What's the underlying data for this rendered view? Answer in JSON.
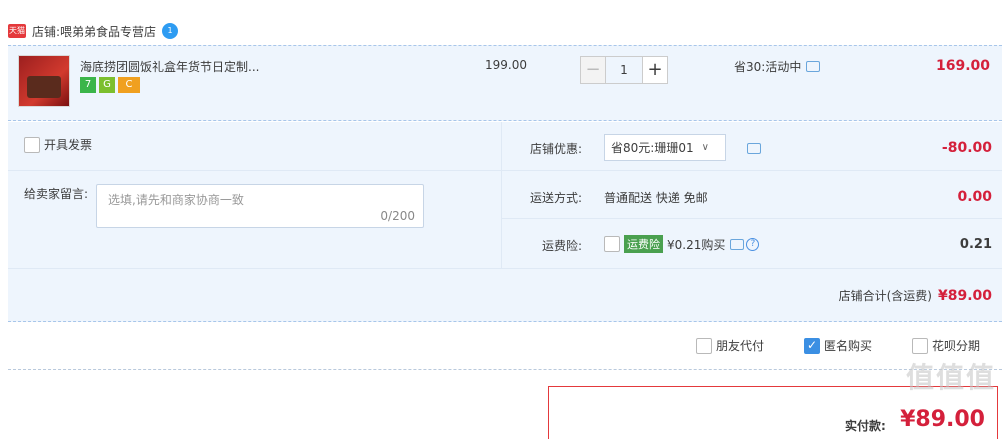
{
  "shop": {
    "badge": "天猫",
    "label": "店铺:",
    "name": "喂弟弟食品专营店",
    "ww_badge": "1"
  },
  "item": {
    "title": "海底捞团圆饭礼盒年货节日定制...",
    "tags": [
      "7",
      "G",
      "C"
    ],
    "unit_price": "199.00",
    "quantity": "1",
    "qty_minus": "−",
    "qty_plus": "+",
    "promo": "省30:活动中",
    "total": "169.00"
  },
  "options": {
    "invoice_label": "开具发票",
    "message_label": "给卖家留言:",
    "message_placeholder": "选填,请先和商家协商一致",
    "message_count": "0/200",
    "discount_label": "店铺优惠:",
    "discount_select": "省80元:珊珊01",
    "discount_value": "-80.00",
    "shipping_label": "运送方式:",
    "shipping_text": "普通配送 快递 免邮",
    "shipping_value": "0.00",
    "insurance_label": "运费险:",
    "insurance_tag": "运费险",
    "insurance_text": "¥0.21购买",
    "insurance_value": "0.21",
    "shop_total_label": "店铺合计(含运费)",
    "shop_total_value": "¥89.00"
  },
  "checkout_options": {
    "friend_pay": "朋友代付",
    "anonymous": "匿名购买",
    "huabei": "花呗分期"
  },
  "payment": {
    "label": "实付款:",
    "value": "¥89.00"
  },
  "watermark": "值值值"
}
